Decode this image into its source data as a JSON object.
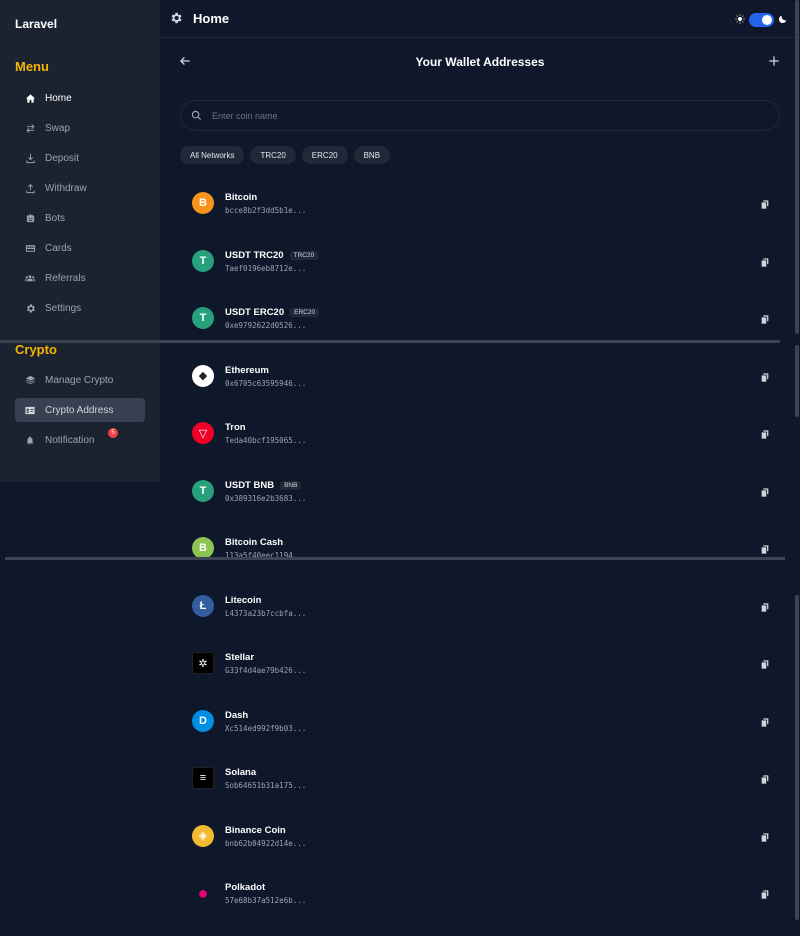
{
  "brand": "Laravel",
  "sidebar": {
    "menu_title": "Menu",
    "menu_items": [
      {
        "label": "Home",
        "icon": "home-icon"
      },
      {
        "label": "Swap",
        "icon": "swap-icon"
      },
      {
        "label": "Deposit",
        "icon": "deposit-icon"
      },
      {
        "label": "Withdraw",
        "icon": "withdraw-icon"
      },
      {
        "label": "Bots",
        "icon": "bot-icon"
      },
      {
        "label": "Cards",
        "icon": "card-icon"
      },
      {
        "label": "Referrals",
        "icon": "users-icon"
      },
      {
        "label": "Settings",
        "icon": "gear-icon"
      }
    ],
    "crypto_title": "Crypto",
    "crypto_items": [
      {
        "label": "Manage Crypto",
        "icon": "layers-icon"
      },
      {
        "label": "Crypto Address",
        "icon": "id-card-icon"
      },
      {
        "label": "Notification",
        "icon": "bell-icon",
        "badge": "5"
      }
    ]
  },
  "header": {
    "title": "Home"
  },
  "page": {
    "title": "Your Wallet Addresses"
  },
  "search": {
    "placeholder": "Enter coin name"
  },
  "filters": [
    "All Networks",
    "TRC20",
    "ERC20",
    "BNB"
  ],
  "wallets": [
    {
      "name": "Bitcoin",
      "tag": "",
      "address": "bcce8b2f3dd5b1e...",
      "color": "#f7931a",
      "glyph": "B"
    },
    {
      "name": "USDT TRC20",
      "tag": "TRC20",
      "address": "Taef0196eb8712e...",
      "color": "#26a17b",
      "glyph": "T"
    },
    {
      "name": "USDT ERC20",
      "tag": "ERC20",
      "address": "0xe9792622d0526...",
      "color": "#26a17b",
      "glyph": "T"
    },
    {
      "name": "Ethereum",
      "tag": "",
      "address": "0x6705c63595946...",
      "color": "#ffffff",
      "glyph": "◆"
    },
    {
      "name": "Tron",
      "tag": "",
      "address": "Teda40bcf195065...",
      "color": "#ef0027",
      "glyph": "▽"
    },
    {
      "name": "USDT BNB",
      "tag": "BNB",
      "address": "0x389316e2b3683...",
      "color": "#26a17b",
      "glyph": "T"
    },
    {
      "name": "Bitcoin Cash",
      "tag": "",
      "address": "113a5f40eec1194...",
      "color": "#8dc351",
      "glyph": "B"
    },
    {
      "name": "Litecoin",
      "tag": "",
      "address": "L4373a23b7ccbfa...",
      "color": "#345d9d",
      "glyph": "Ł"
    },
    {
      "name": "Stellar",
      "tag": "",
      "address": "G33f4d4ae79b426...",
      "color": "#000000",
      "glyph": "✲"
    },
    {
      "name": "Dash",
      "tag": "",
      "address": "Xc514ed992f9b03...",
      "color": "#008de4",
      "glyph": "D"
    },
    {
      "name": "Solana",
      "tag": "",
      "address": "Sob64651b31a175...",
      "color": "#000000",
      "glyph": "≡"
    },
    {
      "name": "Binance Coin",
      "tag": "",
      "address": "bnb62b04922d14e...",
      "color": "#f3ba2f",
      "glyph": "◈"
    },
    {
      "name": "Polkadot",
      "tag": "",
      "address": "57e68b37a512e6b...",
      "color": "#0f172a",
      "glyph": "●"
    }
  ]
}
